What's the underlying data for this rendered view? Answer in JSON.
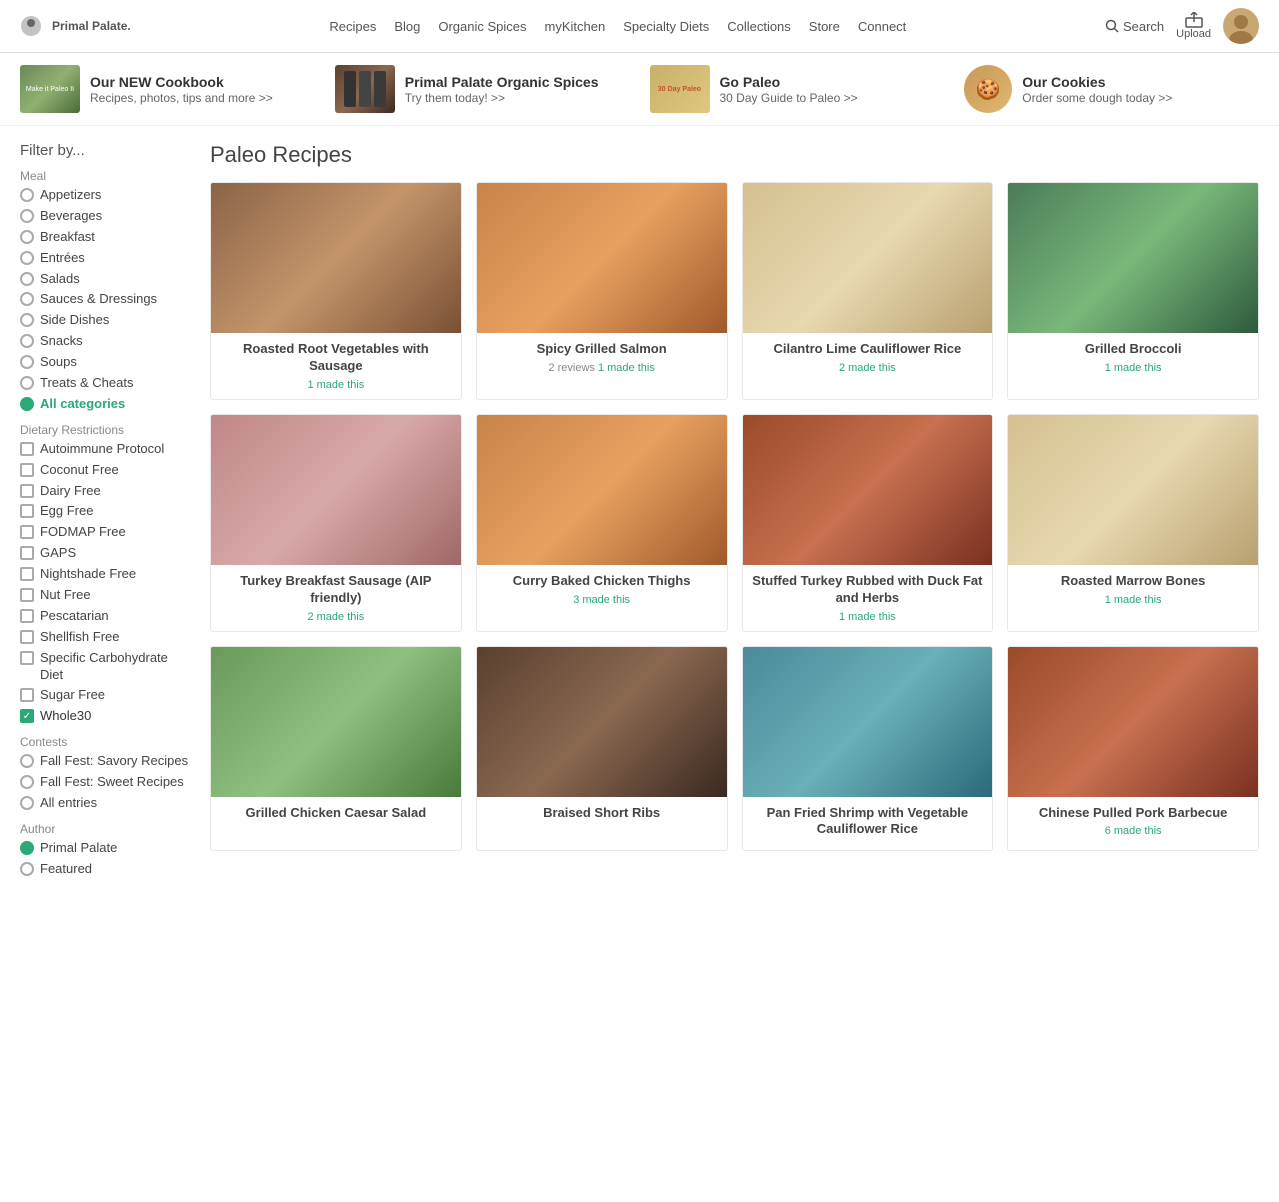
{
  "header": {
    "logo": "Primal Palate.",
    "logo_subtitle": "",
    "nav": [
      "Recipes",
      "Blog",
      "Organic Spices",
      "myKitchen",
      "Specialty Diets",
      "Collections",
      "Store",
      "Connect"
    ],
    "search_label": "Search",
    "upload_label": "Upload"
  },
  "promo": [
    {
      "id": "cookbook",
      "title": "Our NEW Cookbook",
      "subtitle": "Recipes, photos, tips and more >>",
      "color": "img-green"
    },
    {
      "id": "spices",
      "title": "Primal Palate Organic Spices",
      "subtitle": "Try them today! >>",
      "color": "img-dark"
    },
    {
      "id": "paleo",
      "title": "Go Paleo",
      "subtitle": "30 Day Guide to Paleo >>",
      "color": "img-cream"
    },
    {
      "id": "cookies",
      "title": "Our Cookies",
      "subtitle": "Order some dough today >>",
      "color": "img-orange"
    }
  ],
  "sidebar": {
    "filter_title": "Filter by...",
    "meal_label": "Meal",
    "meal_items": [
      {
        "label": "Appetizers",
        "selected": false
      },
      {
        "label": "Beverages",
        "selected": false
      },
      {
        "label": "Breakfast",
        "selected": false
      },
      {
        "label": "Entrées",
        "selected": false
      },
      {
        "label": "Salads",
        "selected": false
      },
      {
        "label": "Sauces & Dressings",
        "selected": false
      },
      {
        "label": "Side Dishes",
        "selected": false
      },
      {
        "label": "Snacks",
        "selected": false
      },
      {
        "label": "Soups",
        "selected": false
      },
      {
        "label": "Treats & Cheats",
        "selected": false
      },
      {
        "label": "All categories",
        "selected": true
      }
    ],
    "dietary_label": "Dietary Restrictions",
    "dietary_items": [
      {
        "label": "Autoimmune Protocol",
        "checked": false
      },
      {
        "label": "Coconut Free",
        "checked": false
      },
      {
        "label": "Dairy Free",
        "checked": false
      },
      {
        "label": "Egg Free",
        "checked": false
      },
      {
        "label": "FODMAP Free",
        "checked": false
      },
      {
        "label": "GAPS",
        "checked": false
      },
      {
        "label": "Nightshade Free",
        "checked": false
      },
      {
        "label": "Nut Free",
        "checked": false
      },
      {
        "label": "Pescatarian",
        "checked": false
      },
      {
        "label": "Shellfish Free",
        "checked": false
      },
      {
        "label": "Specific Carbohydrate Diet",
        "checked": false
      },
      {
        "label": "Sugar Free",
        "checked": false
      },
      {
        "label": "Whole30",
        "checked": true
      }
    ],
    "contests_label": "Contests",
    "contest_items": [
      {
        "label": "Fall Fest: Savory Recipes",
        "selected": false
      },
      {
        "label": "Fall Fest: Sweet Recipes",
        "selected": false
      },
      {
        "label": "All entries",
        "selected": false
      }
    ],
    "author_label": "Author",
    "author_items": [
      {
        "label": "Primal Palate",
        "selected": true
      },
      {
        "label": "Featured",
        "selected": false
      }
    ]
  },
  "content": {
    "title": "Paleo Recipes",
    "recipes": [
      {
        "name": "Roasted Root Vegetables with Sausage",
        "reviews": "",
        "made": "1 made this",
        "img_class": "img-brown"
      },
      {
        "name": "Spicy Grilled Salmon",
        "reviews": "2 reviews",
        "made": "1 made this",
        "img_class": "img-orange"
      },
      {
        "name": "Cilantro Lime Cauliflower Rice",
        "reviews": "",
        "made": "2 made this",
        "img_class": "img-cream"
      },
      {
        "name": "Grilled Broccoli",
        "reviews": "",
        "made": "1 made this",
        "img_class": "img-green"
      },
      {
        "name": "Turkey Breakfast Sausage (AIP friendly)",
        "reviews": "",
        "made": "2 made this",
        "img_class": "img-pink"
      },
      {
        "name": "Curry Baked Chicken Thighs",
        "reviews": "",
        "made": "3 made this",
        "img_class": "img-orange"
      },
      {
        "name": "Stuffed Turkey Rubbed with Duck Fat and Herbs",
        "reviews": "",
        "made": "1 made this",
        "img_class": "img-red-brown"
      },
      {
        "name": "Roasted Marrow Bones",
        "reviews": "",
        "made": "1 made this",
        "img_class": "img-cream"
      },
      {
        "name": "Grilled Chicken Caesar Salad",
        "reviews": "",
        "made": "",
        "img_class": "img-light-green"
      },
      {
        "name": "Braised Short Ribs",
        "reviews": "",
        "made": "",
        "img_class": "img-dark"
      },
      {
        "name": "Pan Fried Shrimp with Vegetable Cauliflower Rice",
        "reviews": "",
        "made": "",
        "img_class": "img-blue-teal"
      },
      {
        "name": "Chinese Pulled Pork Barbecue",
        "reviews": "",
        "made": "6 made this",
        "img_class": "img-red-brown"
      }
    ]
  }
}
